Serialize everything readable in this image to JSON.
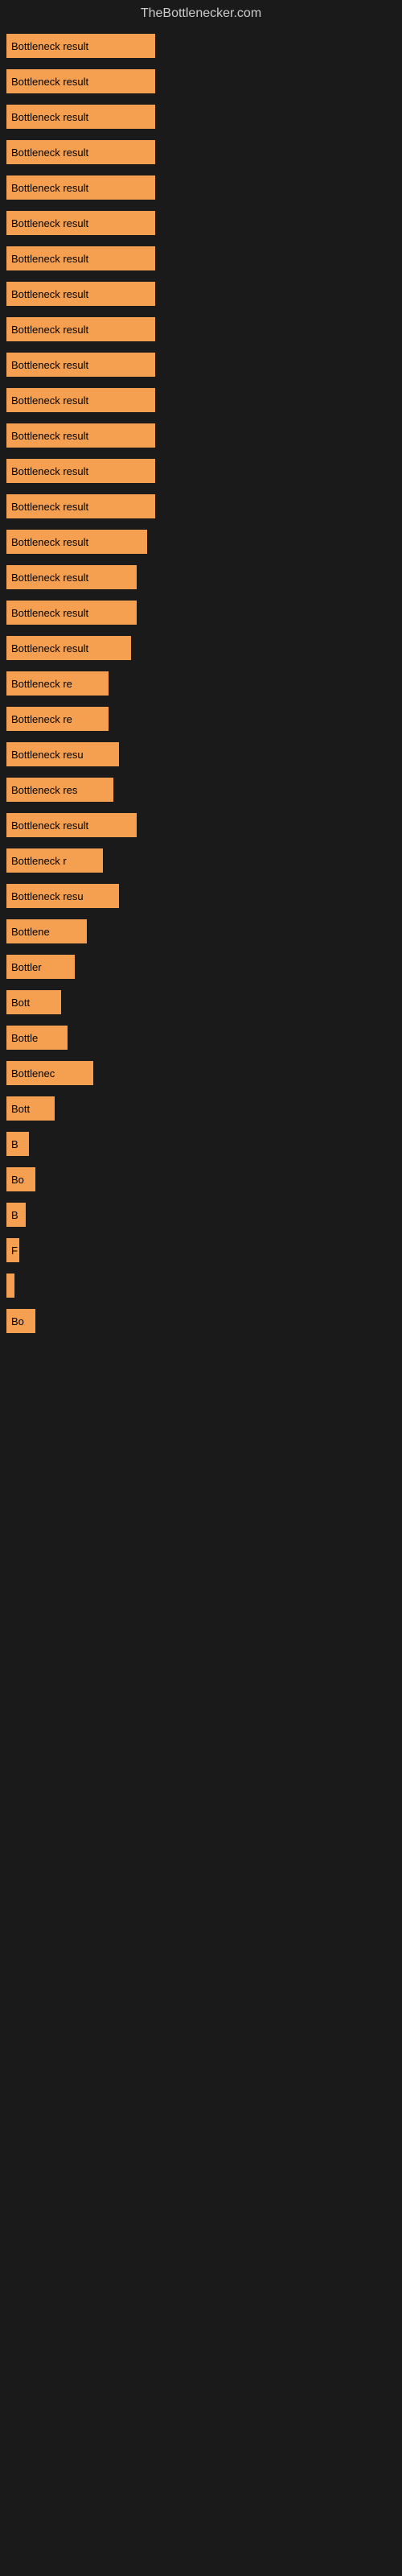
{
  "site": {
    "title": "TheBottlenecker.com"
  },
  "bars": [
    {
      "label": "Bottleneck result",
      "width": 185
    },
    {
      "label": "Bottleneck result",
      "width": 185
    },
    {
      "label": "Bottleneck result",
      "width": 185
    },
    {
      "label": "Bottleneck result",
      "width": 185
    },
    {
      "label": "Bottleneck result",
      "width": 185
    },
    {
      "label": "Bottleneck result",
      "width": 185
    },
    {
      "label": "Bottleneck result",
      "width": 185
    },
    {
      "label": "Bottleneck result",
      "width": 185
    },
    {
      "label": "Bottleneck result",
      "width": 185
    },
    {
      "label": "Bottleneck result",
      "width": 185
    },
    {
      "label": "Bottleneck result",
      "width": 185
    },
    {
      "label": "Bottleneck result",
      "width": 185
    },
    {
      "label": "Bottleneck result",
      "width": 185
    },
    {
      "label": "Bottleneck result",
      "width": 185
    },
    {
      "label": "Bottleneck result",
      "width": 175
    },
    {
      "label": "Bottleneck result",
      "width": 162
    },
    {
      "label": "Bottleneck result",
      "width": 162
    },
    {
      "label": "Bottleneck result",
      "width": 155
    },
    {
      "label": "Bottleneck re",
      "width": 127
    },
    {
      "label": "Bottleneck re",
      "width": 127
    },
    {
      "label": "Bottleneck resu",
      "width": 140
    },
    {
      "label": "Bottleneck res",
      "width": 133
    },
    {
      "label": "Bottleneck result",
      "width": 162
    },
    {
      "label": "Bottleneck r",
      "width": 120
    },
    {
      "label": "Bottleneck resu",
      "width": 140
    },
    {
      "label": "Bottlene",
      "width": 100
    },
    {
      "label": "Bottler",
      "width": 85
    },
    {
      "label": "Bott",
      "width": 68
    },
    {
      "label": "Bottle",
      "width": 76
    },
    {
      "label": "Bottlenec",
      "width": 108
    },
    {
      "label": "Bott",
      "width": 60
    },
    {
      "label": "B",
      "width": 28
    },
    {
      "label": "Bo",
      "width": 36
    },
    {
      "label": "B",
      "width": 24
    },
    {
      "label": "F",
      "width": 16
    },
    {
      "label": "",
      "width": 10
    },
    {
      "label": "Bo",
      "width": 36
    }
  ]
}
